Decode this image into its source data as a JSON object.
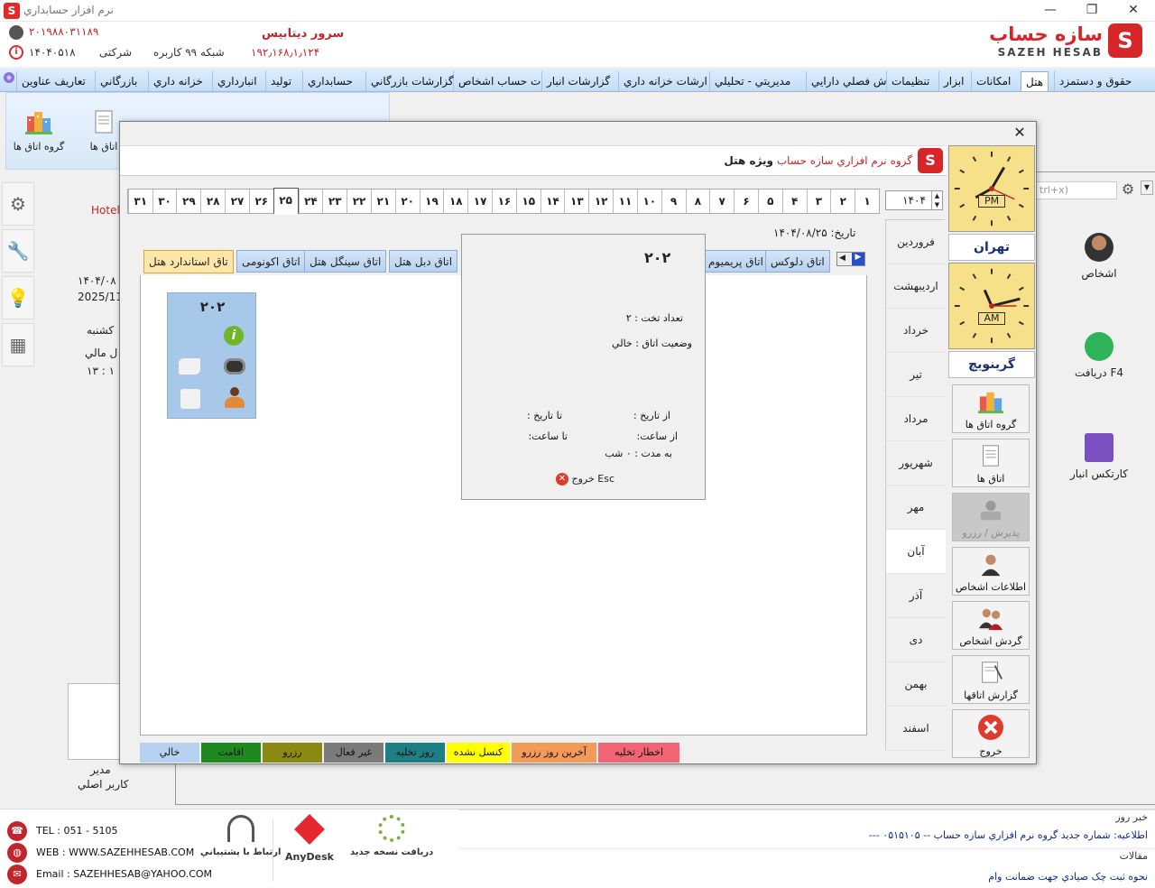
{
  "window": {
    "title": "نرم افزار حسابداري",
    "minimize": "—",
    "restore": "❐",
    "close": "✕"
  },
  "header": {
    "phone1": "۲۰۱۹۸۸۰۳۱۱۸۹",
    "phone2": "۱۴۰۴۰۵۱۸",
    "company_label": "شرکتی",
    "network_label": "شبکه ۹۹ کاربره",
    "server_label": "سرور ديتابيس",
    "server_ip": "۱۹۲٫۱۶۸٫۱٫۱۲۴",
    "logo_fa": "سازه حساب",
    "logo_en": "SAZEH HESAB"
  },
  "menu": {
    "tabs": [
      "حقوق و دستمزد",
      "هتل",
      "امکانات",
      "ابزار",
      "تنظیمات",
      "ش فصلي دارايي",
      "مديريتي - تحليلي",
      "ارشات خزانه داري",
      "گزارشات انبار",
      "ت حساب اشخاص",
      "گزارشات بازرگاني",
      "حسابداري",
      "توليد",
      "انبارداري",
      "خزانه داري",
      "بازرگاني",
      "تعاريف عناوين"
    ],
    "active_index": 1
  },
  "ribbon": {
    "items": [
      "گروه اتاق ها",
      "اتاق ها"
    ]
  },
  "background": {
    "hotel_text": "Hotel",
    "date_fa": "۱۴۰۴/۰۸",
    "date_en": "2025/11",
    "weekday": "کشنبه",
    "fiscal": "ل مالي",
    "time": "۱۳ : ۱",
    "search_hint": "trl+x)",
    "user_role": "مدير",
    "user_name": "کاربر اصلي",
    "right_items": [
      "اشخاص",
      "F4   دريافت",
      "کارتکس انبار"
    ]
  },
  "bottom": {
    "tel": "TEL : 051 - 5105",
    "web": "WEB : WWW.SAZEHHESAB.COM",
    "email": "Email : SAZEHHESAB@YAHOO.COM",
    "support": "ارتباط با پشتيباني",
    "anydesk": "AnyDesk",
    "update": "دريافت نسخه جديد",
    "news_title": "خبر روز",
    "news_text": "اطلاعيه: شماره جديد گروه نرم افزاري سازه حساب -- ۰۵۱۵۱۰۵ ---",
    "articles_title": "مقالات",
    "article_text": "نحوه ثبت چک صيادي جهت ضمانت وام"
  },
  "dialog": {
    "close": "✕",
    "banner_company": "گروه نرم افزاري سازه حساب",
    "banner_special": "ويژه هتل",
    "year": "۱۴۰۴",
    "days": [
      "۱",
      "۲",
      "۳",
      "۴",
      "۵",
      "۶",
      "۷",
      "۸",
      "۹",
      "۱۰",
      "۱۱",
      "۱۲",
      "۱۳",
      "۱۴",
      "۱۵",
      "۱۶",
      "۱۷",
      "۱۸",
      "۱۹",
      "۲۰",
      "۲۱",
      "۲۲",
      "۲۳",
      "۲۴",
      "۲۵",
      "۲۶",
      "۲۷",
      "۲۸",
      "۲۹",
      "۳۰",
      "۳۱"
    ],
    "selected_day": "۲۵",
    "date_label": "تاريخ:",
    "date_value": "۱۴۰۴/۰۸/۲۵",
    "months": [
      "فروردين",
      "ارديبهشت",
      "خرداد",
      "تير",
      "مرداد",
      "شهريور",
      "مهر",
      "آبان",
      "آذر",
      "دی",
      "بهمن",
      "اسفند"
    ],
    "selected_month": "آبان",
    "clocks": [
      {
        "ampm": "PM",
        "city": "تهران"
      },
      {
        "ampm": "AM",
        "city": "گرينويچ"
      }
    ],
    "side_buttons": [
      {
        "label": "گروه اتاق ها",
        "icon": "building-icon"
      },
      {
        "label": "اتاق ها",
        "icon": "room-list-icon"
      },
      {
        "label": "پذيرش / رزرو",
        "icon": "reception-icon"
      },
      {
        "label": "اطلاعات اشخاص",
        "icon": "person-icon"
      },
      {
        "label": "گردش اشخاص",
        "icon": "people-icon"
      },
      {
        "label": "گزارش اتاقها",
        "icon": "report-icon"
      },
      {
        "label": "خروج",
        "icon": "exit-icon"
      }
    ],
    "room_tabs": [
      "تاق استاندارد هتل",
      "اتاق اکونومی",
      "اتاق سينگل هتل",
      "اتاق دبل هتل",
      "اتاق پريميوم",
      "اتاق دلوکس"
    ],
    "room_card_number": "۲۰۲",
    "popup": {
      "room": "۲۰۲",
      "beds": "تعداد تخت : ۲",
      "status": "وضعيت اتاق : خالي",
      "from_date": "از تاريخ :",
      "to_date": "تا تاريخ :",
      "from_time": "از ساعت:",
      "to_time": "تا ساعت:",
      "duration": "به مدت : ۰ شب",
      "exit": "خروج Esc"
    },
    "legend": [
      {
        "label": "خالي",
        "color": "#b7d1f0"
      },
      {
        "label": "اقامت",
        "color": "#1e8a1e"
      },
      {
        "label": "رزرو",
        "color": "#8a8a12"
      },
      {
        "label": "غير فعال",
        "color": "#7b7b7b"
      },
      {
        "label": "روز تخليه",
        "color": "#1d7f83"
      },
      {
        "label": "کنسل نشده",
        "color": "#ffff00"
      },
      {
        "label": "آخرين روز رزرو",
        "color": "#f39a58"
      },
      {
        "label": "اخطار تخليه",
        "color": "#f06474"
      }
    ]
  }
}
